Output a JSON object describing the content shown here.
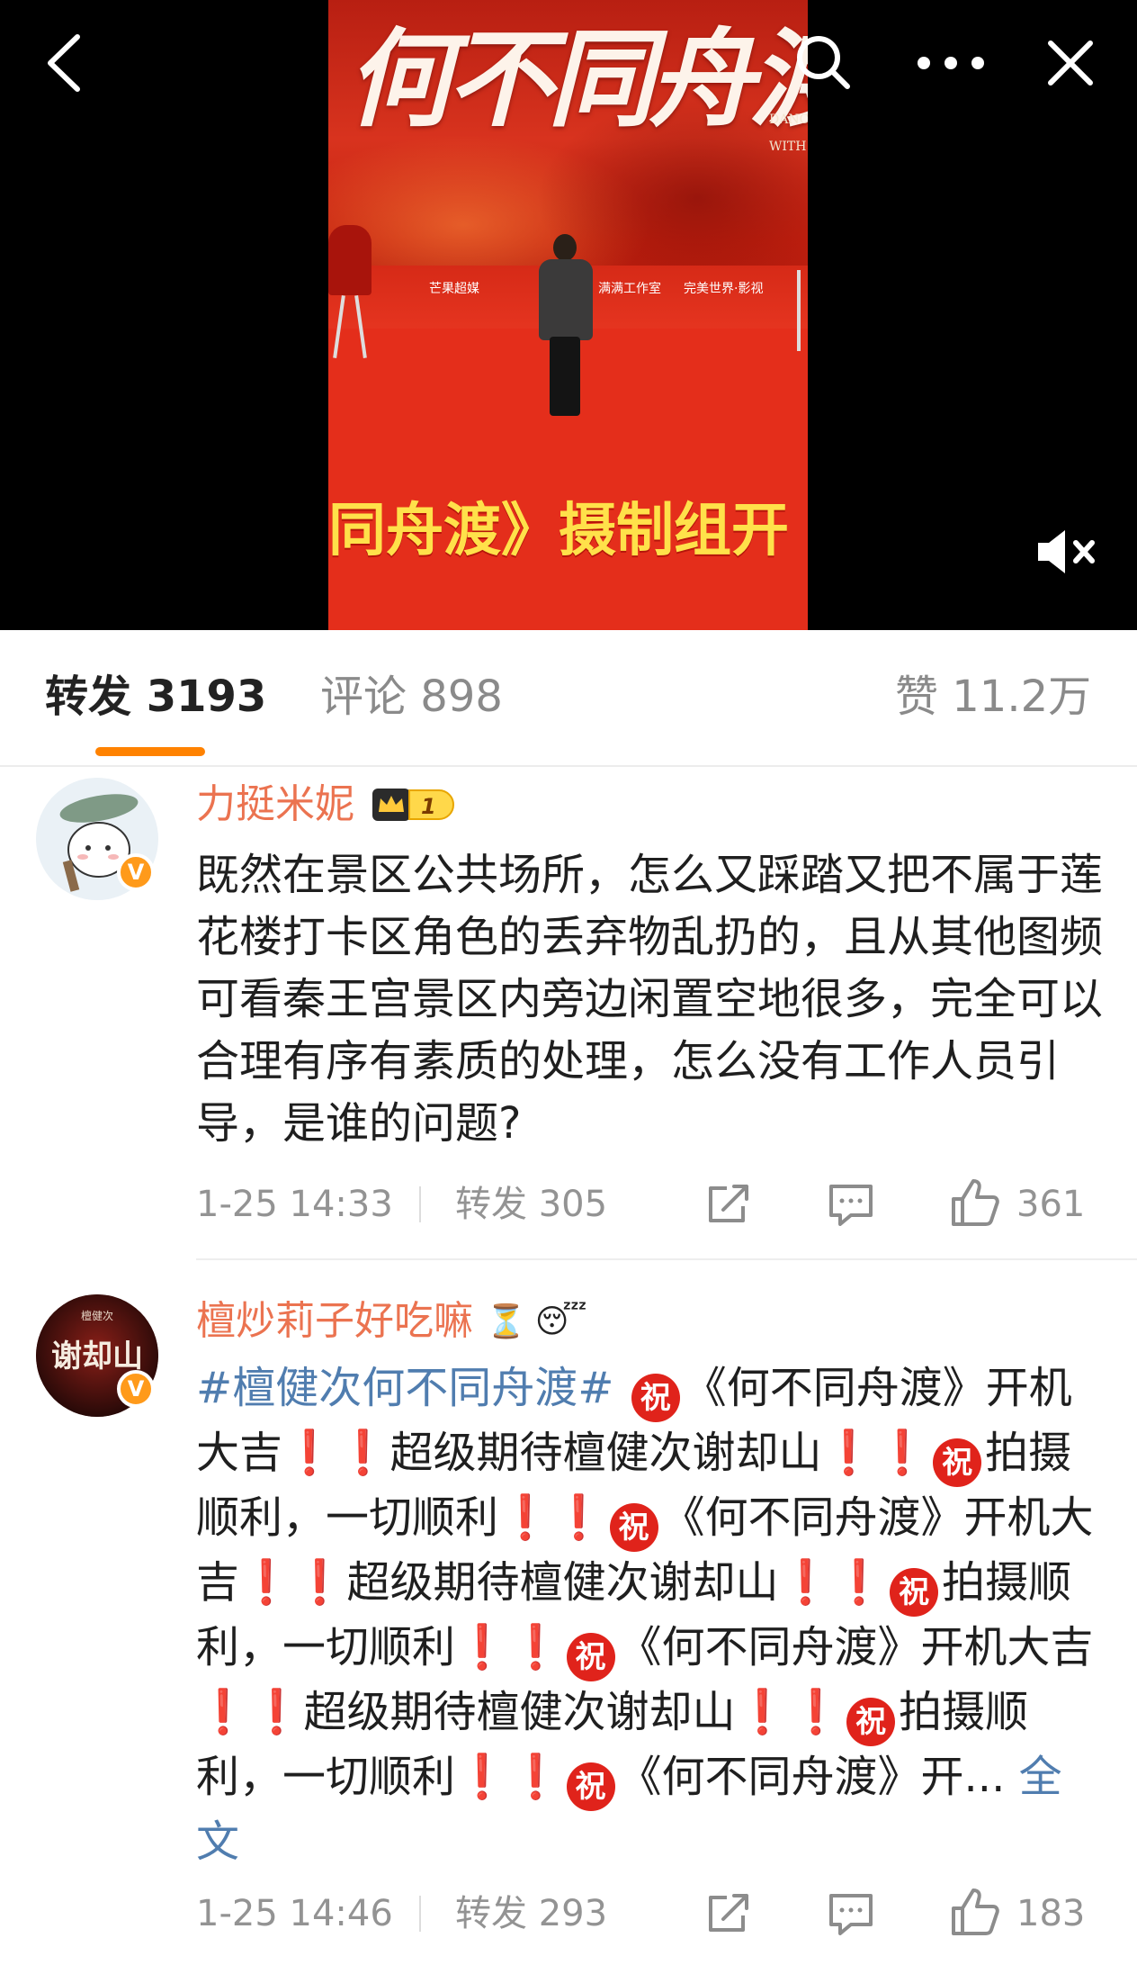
{
  "video": {
    "poster_title_art": "何不同舟渡",
    "poster_subtitle_lines": [
      "DANCIN",
      "WITH T"
    ],
    "poster_logos": [
      "芒果超媒",
      "满满工作室",
      "完美世界·影视"
    ],
    "poster_banner": "同舟渡》摄制组开"
  },
  "tabs": {
    "repost_label": "转发 3193",
    "comment_label": "评论 898",
    "like_label": "赞 11.2万",
    "active": "repost"
  },
  "icons": {
    "back": "chevron-left-icon",
    "search": "search-icon",
    "more": "more-dots-icon",
    "close": "close-icon",
    "mute": "speaker-muted-icon",
    "share": "share-icon",
    "reply": "comment-icon",
    "like": "thumbs-up-icon",
    "verified": "verified-badge-icon"
  },
  "colors": {
    "accent": "#ff8200",
    "username": "#eb7350",
    "link": "#507daf",
    "meta": "#939393"
  },
  "comments": [
    {
      "username": "力挺米妮",
      "badge_level": "1",
      "text": "既然在景区公共场所，怎么又踩踏又把不属于莲花楼打卡区角色的丢弃物乱扔的，且从其他图频可看秦王宫景区内旁边闲置空地很多，完全可以合理有序有素质的处理，怎么没有工作人员引导，是谁的问题?",
      "time": "1-25 14:33",
      "repost": "转发 305",
      "likes": "361"
    },
    {
      "username": "檀炒莉子好吃嘛",
      "user_emoji_1": "⏳",
      "user_emoji_2": "😴",
      "hashtag": "#檀健次何不同舟渡#",
      "zhu": "祝",
      "seg_open": "《何不同舟渡》开机大吉",
      "seg_open_line_start": "《何",
      "seg_open_line_rest": "不同舟渡》开机大吉",
      "seg_open_wrap_a": "《何不同舟",
      "seg_open_wrap_b": "渡》开机大吉",
      "seg_expect": "超级期待檀健次谢却山",
      "seg_expect_a": "超级期待檀健次",
      "seg_expect_b": "谢却山",
      "seg_wish": "拍摄顺利，一切顺利",
      "ex": "❗",
      "truncated_tail": "《何不同舟渡》开...",
      "full_text_link": "全文",
      "avatar_text": "谢却山",
      "avatar_caption": "檀健次",
      "time": "1-25 14:46",
      "repost": "转发 293",
      "likes": "183"
    }
  ]
}
